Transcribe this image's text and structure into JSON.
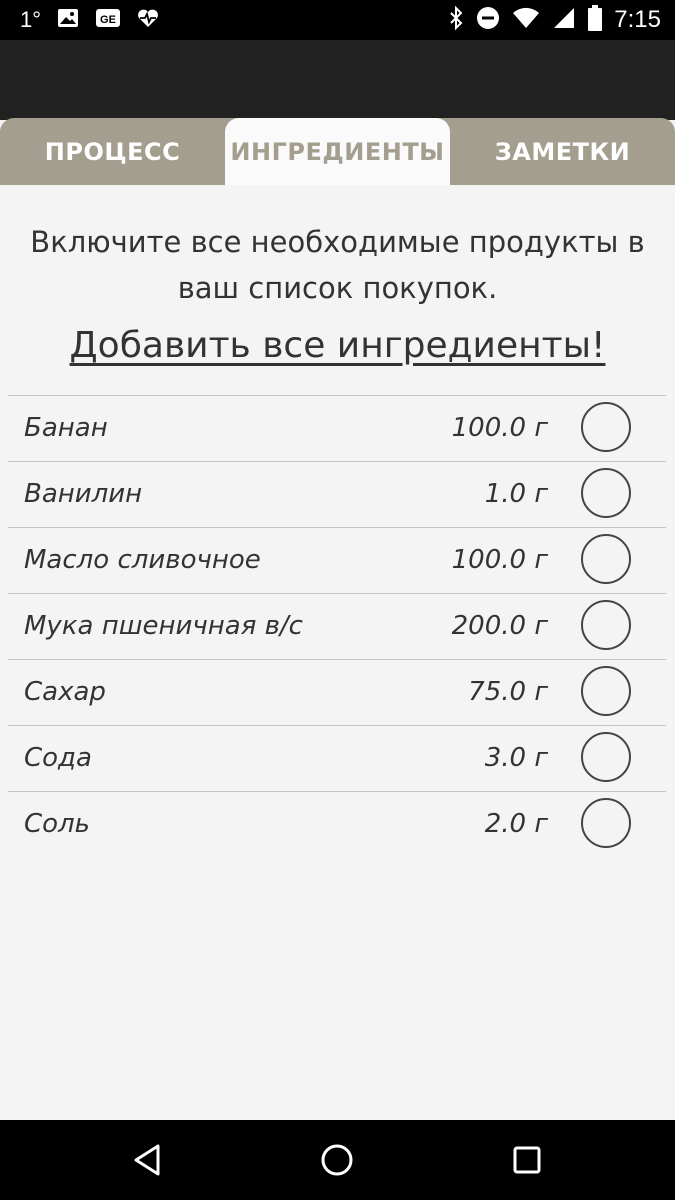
{
  "status_bar": {
    "temperature": "1°",
    "time": "7:15",
    "icons": [
      "image-icon",
      "ge-icon",
      "heart-pulse-icon",
      "bluetooth-icon",
      "do-not-disturb-icon",
      "wifi-icon",
      "signal-icon",
      "battery-icon"
    ]
  },
  "tabs": [
    {
      "label": "ПРОЦЕСС",
      "active": false
    },
    {
      "label": "ИНГРЕДИЕНТЫ",
      "active": true
    },
    {
      "label": "ЗАМЕТКИ",
      "active": false
    }
  ],
  "content": {
    "intro": "Включите все необходимые продукты в ваш список покупок.",
    "add_all": "Добавить все ингредиенты!"
  },
  "ingredients": [
    {
      "name": "Банан",
      "amount": "100.0 г",
      "checked": false
    },
    {
      "name": "Ванилин",
      "amount": "1.0 г",
      "checked": false
    },
    {
      "name": "Масло сливочное",
      "amount": "100.0 г",
      "checked": false
    },
    {
      "name": "Мука пшеничная в/с",
      "amount": "200.0 г",
      "checked": false
    },
    {
      "name": "Сахар",
      "amount": "75.0 г",
      "checked": false
    },
    {
      "name": "Сода",
      "amount": "3.0 г",
      "checked": false
    },
    {
      "name": "Соль",
      "amount": "2.0 г",
      "checked": false
    }
  ],
  "colors": {
    "tab_bar": "#a39e8e",
    "app_bar": "#212121",
    "background": "#f4f4f4"
  }
}
